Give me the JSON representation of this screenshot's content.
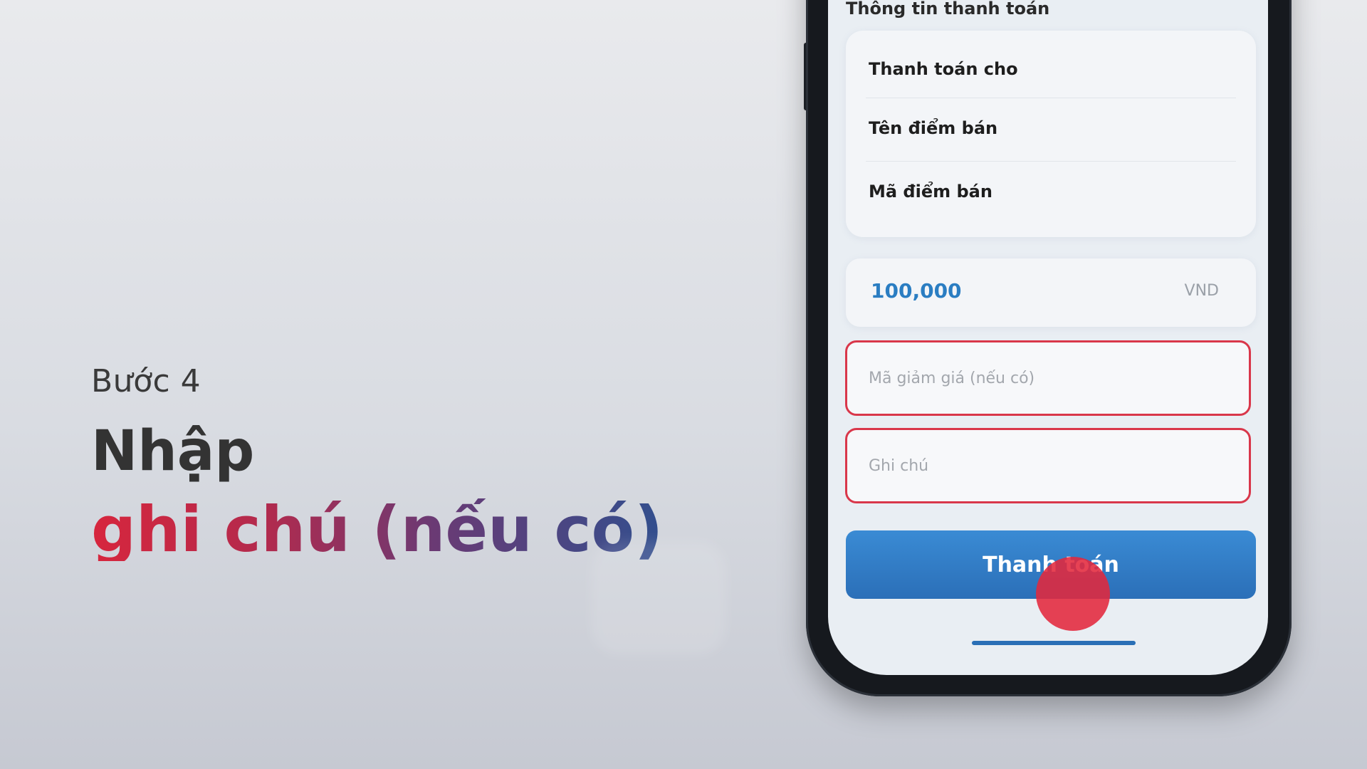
{
  "caption": {
    "step": "Bước 4",
    "line1": "Nhập",
    "line2": "ghi chú (nếu có)"
  },
  "phone": {
    "section_title": "Thông tin thanh toán",
    "info_rows": [
      {
        "label": "Thanh toán cho"
      },
      {
        "label": "Tên điểm bán"
      },
      {
        "label": "Mã điểm bán"
      }
    ],
    "amount": {
      "value": "100,000",
      "currency": "VND"
    },
    "discount_input": {
      "placeholder": "Mã giảm giá (nếu có)",
      "value": ""
    },
    "note_input": {
      "placeholder": "Ghi chú",
      "value": ""
    },
    "pay_button_label": "Thanh toán"
  },
  "colors": {
    "accent_blue": "#2b6fb8",
    "highlight_red": "#d9374a",
    "amount_blue": "#2a7dc2"
  }
}
